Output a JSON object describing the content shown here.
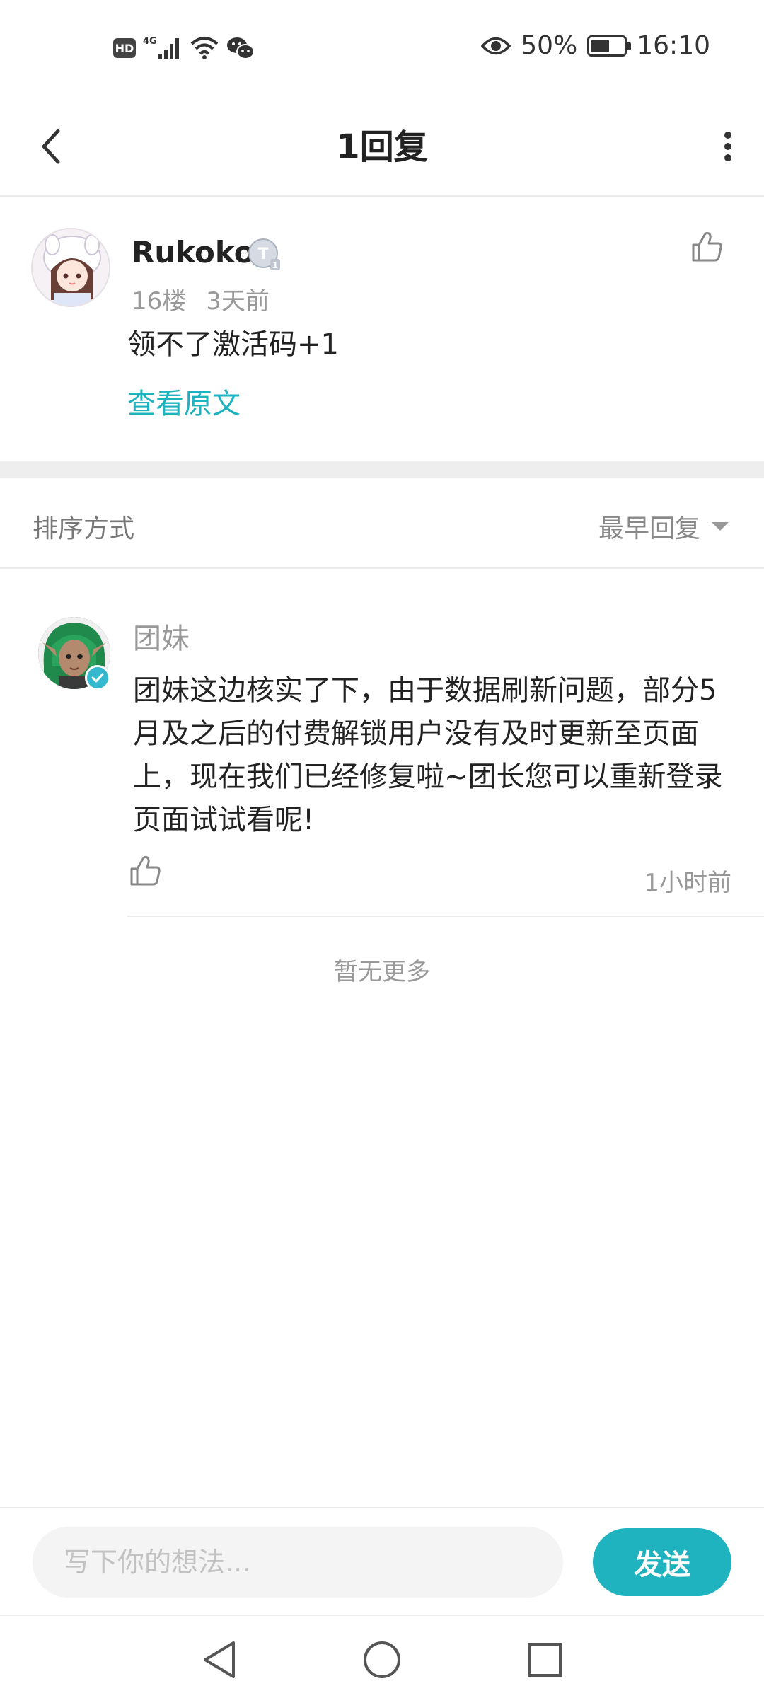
{
  "status_bar": {
    "hd": "HD",
    "network": "4G",
    "battery_percent": "50%",
    "battery_level": 0.5,
    "time": "16:10"
  },
  "header": {
    "title": "1回复"
  },
  "post": {
    "username": "Rukoko",
    "floor": "16楼",
    "time": "3天前",
    "content": "领不了激活码+1",
    "view_original": "查看原文"
  },
  "sort": {
    "label": "排序方式",
    "value": "最早回复"
  },
  "reply": {
    "username": "团妹",
    "content": "团妹这边核实了下，由于数据刷新问题，部分5月及之后的付费解锁用户没有及时更新至页面上，现在我们已经修复啦~团长您可以重新登录页面试试看呢!",
    "time": "1小时前"
  },
  "footer_note": "暂无更多",
  "input": {
    "placeholder": "写下你的想法...",
    "send_label": "发送"
  },
  "colors": {
    "accent": "#1fb2bf",
    "muted_text": "#999999",
    "primary_text": "#222222"
  }
}
